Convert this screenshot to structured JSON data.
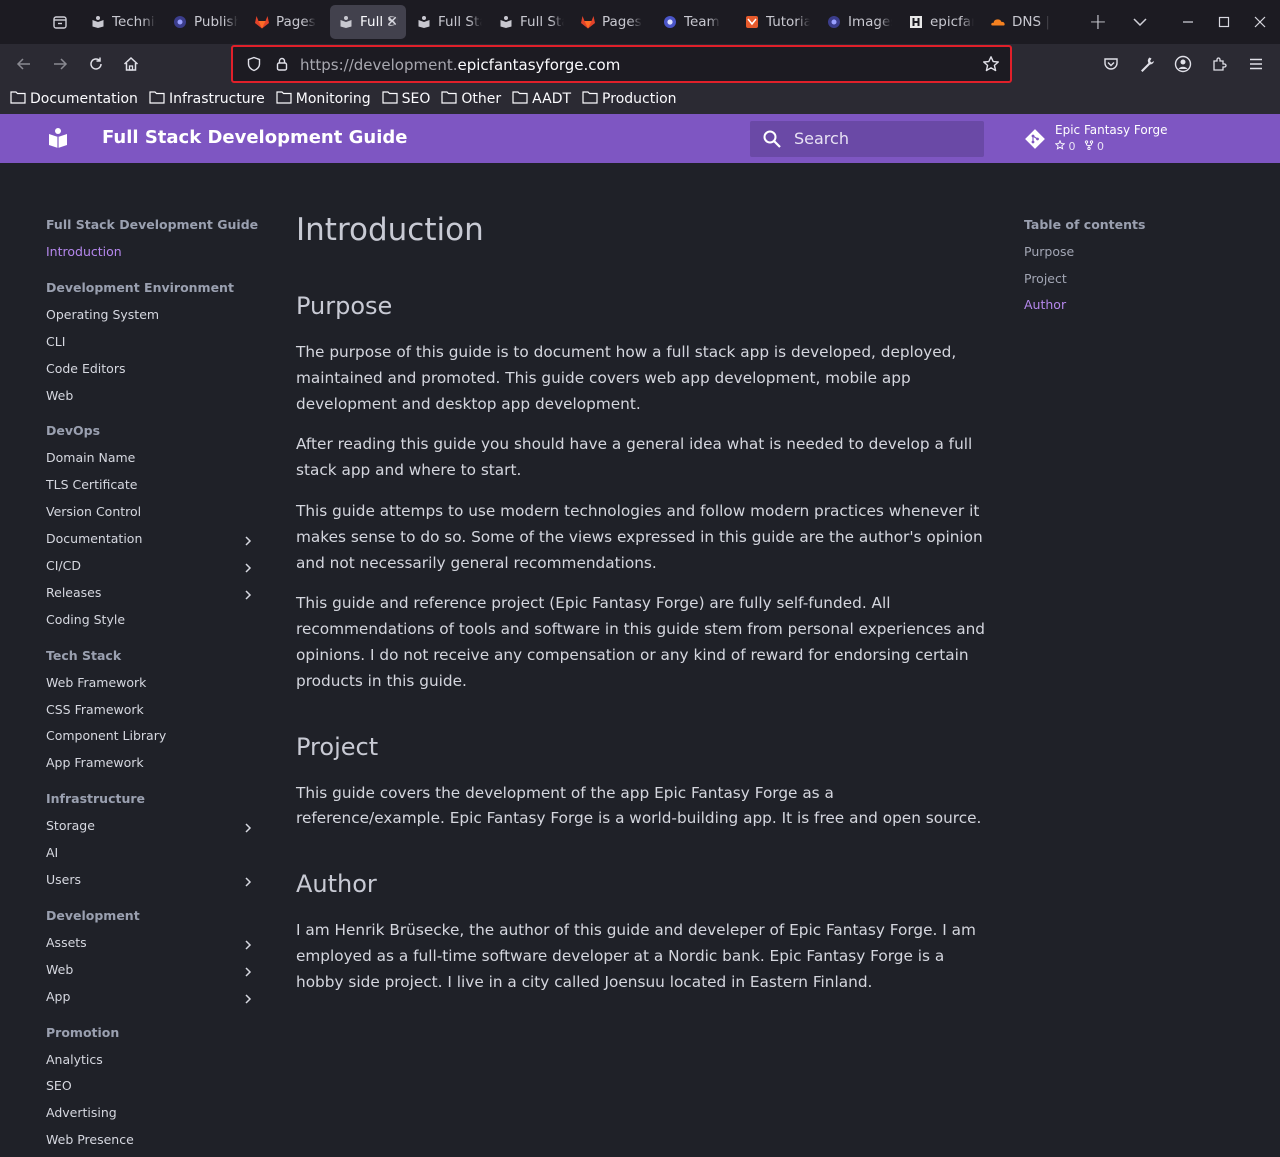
{
  "browser": {
    "tabs": [
      {
        "title": "Technical",
        "icon": "mkdocs-icon"
      },
      {
        "title": "Publish",
        "icon": "astro-icon"
      },
      {
        "title": "Pages",
        "icon": "gitlab-icon"
      },
      {
        "title": "Full Stack",
        "icon": "mkdocs-icon",
        "active": true
      },
      {
        "title": "Full Stack",
        "icon": "mkdocs-icon"
      },
      {
        "title": "Full Stack",
        "icon": "mkdocs-icon"
      },
      {
        "title": "Pages",
        "icon": "gitlab-icon"
      },
      {
        "title": "Team",
        "icon": "tauri-icon"
      },
      {
        "title": "Tutorial",
        "icon": "svelte-icon"
      },
      {
        "title": "Images",
        "icon": "astro-icon"
      },
      {
        "title": "epicfantasyforge",
        "icon": "h-icon"
      },
      {
        "title": "DNS |",
        "icon": "cloudflare-icon"
      }
    ],
    "url_prefix": "https://development.",
    "url_domain": "epicfantasyforge.com",
    "bookmarks": [
      "Documentation",
      "Infrastructure",
      "Monitoring",
      "SEO",
      "Other",
      "AADT",
      "Production"
    ]
  },
  "header": {
    "title": "Full Stack Development Guide",
    "search_placeholder": "Search",
    "repo_name": "Epic Fantasy Forge",
    "repo_stars": "0",
    "repo_forks": "0"
  },
  "sidebar": [
    {
      "heading": "Full Stack Development Guide",
      "items": [
        {
          "label": "Introduction",
          "current": true
        }
      ]
    },
    {
      "heading": "Development Environment",
      "items": [
        {
          "label": "Operating System"
        },
        {
          "label": "CLI"
        },
        {
          "label": "Code Editors"
        },
        {
          "label": "Web"
        }
      ]
    },
    {
      "heading": "DevOps",
      "items": [
        {
          "label": "Domain Name"
        },
        {
          "label": "TLS Certificate"
        },
        {
          "label": "Version Control"
        },
        {
          "label": "Documentation",
          "expandable": true
        },
        {
          "label": "CI/CD",
          "expandable": true
        },
        {
          "label": "Releases",
          "expandable": true
        },
        {
          "label": "Coding Style"
        }
      ]
    },
    {
      "heading": "Tech Stack",
      "items": [
        {
          "label": "Web Framework"
        },
        {
          "label": "CSS Framework"
        },
        {
          "label": "Component Library"
        },
        {
          "label": "App Framework"
        }
      ]
    },
    {
      "heading": "Infrastructure",
      "items": [
        {
          "label": "Storage",
          "expandable": true
        },
        {
          "label": "AI"
        },
        {
          "label": "Users",
          "expandable": true
        }
      ]
    },
    {
      "heading": "Development",
      "items": [
        {
          "label": "Assets",
          "expandable": true
        },
        {
          "label": "Web",
          "expandable": true
        },
        {
          "label": "App",
          "expandable": true
        }
      ]
    },
    {
      "heading": "Promotion",
      "items": [
        {
          "label": "Analytics"
        },
        {
          "label": "SEO"
        },
        {
          "label": "Advertising"
        },
        {
          "label": "Web Presence"
        }
      ]
    }
  ],
  "content": {
    "title": "Introduction",
    "sections": [
      {
        "heading": "Purpose",
        "paragraphs": [
          "The purpose of this guide is to document how a full stack app is developed, deployed, maintained and promoted. This guide covers web app development, mobile app development and desktop app development.",
          "After reading this guide you should have a general idea what is needed to develop a full stack app and where to start.",
          "This guide attemps to use modern technologies and follow modern practices whenever it makes sense to do so. Some of the views expressed in this guide are the author's opinion and not necessarily general recommendations.",
          "This guide and reference project (Epic Fantasy Forge) are fully self-funded. All recommendations of tools and software in this guide stem from personal experiences and opinions. I do not receive any compensation or any kind of reward for endorsing certain products in this guide."
        ]
      },
      {
        "heading": "Project",
        "paragraphs": [
          "This guide covers the development of the app Epic Fantasy Forge as a reference/example. Epic Fantasy Forge is a world-building app. It is free and open source."
        ]
      },
      {
        "heading": "Author",
        "paragraphs": [
          "I am Henrik Brüsecke, the author of this guide and develeper of Epic Fantasy Forge. I am employed as a full-time software developer at a Nordic bank. Epic Fantasy Forge is a hobby side project. I live in a city called Joensuu located in Eastern Finland."
        ]
      }
    ]
  },
  "toc": {
    "heading": "Table of contents",
    "items": [
      {
        "label": "Purpose"
      },
      {
        "label": "Project"
      },
      {
        "label": "Author",
        "current": true
      }
    ]
  },
  "colors": {
    "accent": "#7e56c2",
    "link_current": "#b487ec",
    "background": "#1f2128"
  }
}
